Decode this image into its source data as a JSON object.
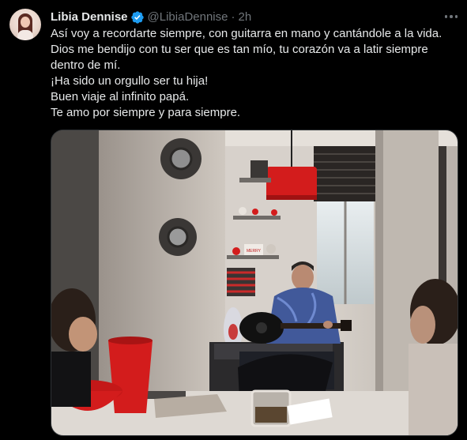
{
  "author": {
    "display_name": "Libia Dennise",
    "handle": "@LibiaDennise",
    "separator": "·",
    "time": "2h",
    "verified_icon": "verified-badge-icon",
    "verified_color": "#1d9bf0"
  },
  "tweet": {
    "lines": [
      "Así voy a recordarte siempre, con guitarra en mano y cantándole a la vida.",
      "Dios me bendijo con tu ser que es tan mío, tu corazón va a latir siempre",
      "dentro de mí.",
      "¡Ha sido un orgullo ser tu hija!",
      "Buen viaje al infinito papá.",
      "Te amo por siempre y para siempre."
    ]
  },
  "media": {
    "description_icon": "photo-man-playing-guitar",
    "shelf_sign_text": "MERRY"
  },
  "colors": {
    "background": "#000000",
    "text": "#e7e9ea",
    "secondary_text": "#71767b",
    "accent_red": "#e0201f"
  }
}
